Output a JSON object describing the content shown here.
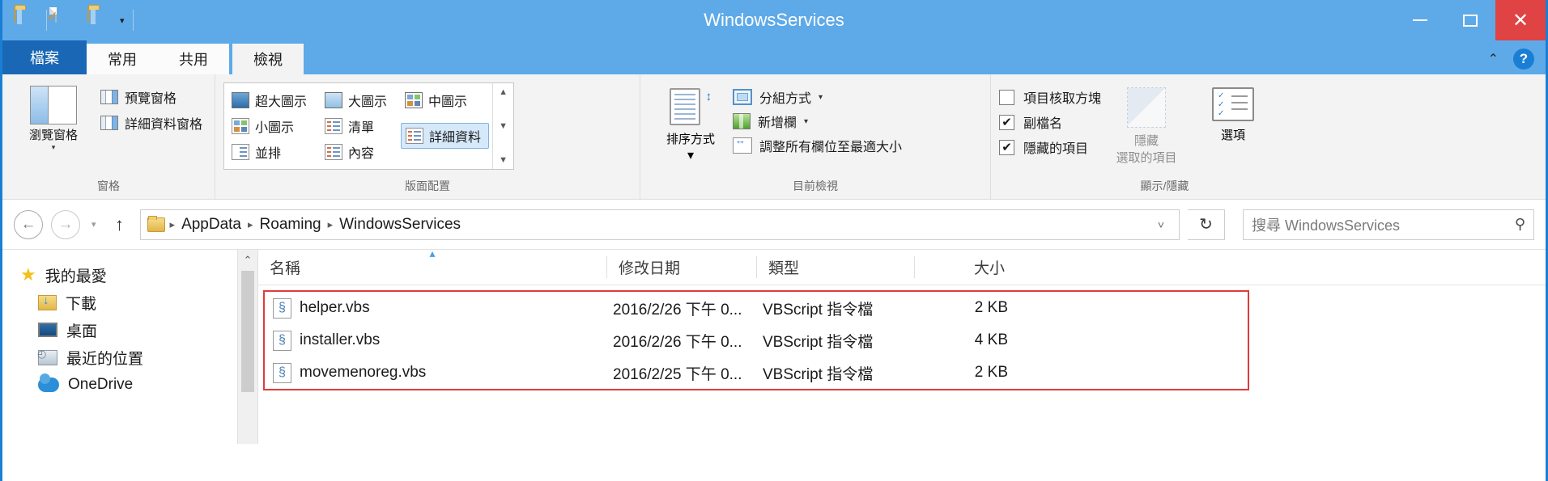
{
  "window": {
    "title": "WindowsServices",
    "minimize_label": "–",
    "maximize_label": "□",
    "close_label": "✕"
  },
  "quick_access": {
    "items": [
      {
        "name": "folder-icon",
        "label": ""
      },
      {
        "name": "new-document-icon",
        "label": ""
      },
      {
        "name": "folder-properties-icon",
        "label": ""
      }
    ],
    "dropdown_caret": "▾"
  },
  "tabs": [
    {
      "id": "file",
      "label": "檔案"
    },
    {
      "id": "home",
      "label": "常用"
    },
    {
      "id": "share",
      "label": "共用"
    },
    {
      "id": "view",
      "label": "檢視"
    }
  ],
  "ribbon_right": {
    "collapse_caret": "⌃",
    "help_label": "?"
  },
  "ribbon": {
    "groups": [
      {
        "id": "panes",
        "label": "窗格",
        "big_button": {
          "label": "瀏覽窗格",
          "caret": "▾"
        },
        "items": [
          {
            "label": "預覽窗格"
          },
          {
            "label": "詳細資料窗格"
          }
        ]
      },
      {
        "id": "layout",
        "label": "版面配置",
        "gallery": [
          {
            "label": "超大圖示",
            "selected": false
          },
          {
            "label": "小圖示",
            "selected": false
          },
          {
            "label": "並排",
            "selected": false
          },
          {
            "label": "大圖示",
            "selected": false
          },
          {
            "label": "清單",
            "selected": false
          },
          {
            "label": "內容",
            "selected": false
          },
          {
            "label": "中圖示",
            "selected": false
          },
          {
            "label": "詳細資料",
            "selected": true
          }
        ],
        "scroll_up": "▲",
        "scroll_down": "▼",
        "scroll_more": "▼"
      },
      {
        "id": "current_view",
        "label": "目前檢視",
        "big_button": {
          "label": "排序方式",
          "caret": "▾"
        },
        "items": [
          {
            "label": "分組方式",
            "caret": "▾"
          },
          {
            "label": "新增欄",
            "caret": "▾"
          },
          {
            "label": "調整所有欄位至最適大小",
            "caret": ""
          }
        ]
      },
      {
        "id": "show_hide",
        "label": "顯示/隱藏",
        "checkboxes": [
          {
            "label": "項目核取方塊",
            "checked": false,
            "mark": ""
          },
          {
            "label": "副檔名",
            "checked": true,
            "mark": "✔"
          },
          {
            "label": "隱藏的項目",
            "checked": true,
            "mark": "✔"
          }
        ],
        "hide_button": {
          "line1": "隱藏",
          "line2": "選取的項目",
          "disabled": true
        },
        "options_button": {
          "label": "選項"
        }
      }
    ]
  },
  "address_bar": {
    "back_label": "←",
    "forward_label": "→",
    "history_caret": "▾",
    "up_label": "↑",
    "breadcrumbs": [
      "AppData",
      "Roaming",
      "WindowsServices"
    ],
    "separator": "▸",
    "dropdown_caret": "˅",
    "refresh_label": "↻",
    "search_placeholder": "搜尋 WindowsServices",
    "search_value": "",
    "search_icon": "⚲"
  },
  "sidebar": {
    "items": [
      {
        "label": "我的最愛",
        "icon": "star-icon",
        "child": false
      },
      {
        "label": "下載",
        "icon": "downloads-icon",
        "child": true
      },
      {
        "label": "桌面",
        "icon": "desktop-icon",
        "child": true
      },
      {
        "label": "最近的位置",
        "icon": "recent-places-icon",
        "child": true
      },
      {
        "label": "OneDrive",
        "icon": "onedrive-icon",
        "child": true
      }
    ]
  },
  "scrollbar": {
    "up_arrow": "⌃",
    "down_arrow": "⌄"
  },
  "file_list": {
    "columns": [
      {
        "key": "name",
        "label": "名稱",
        "sorted": true,
        "sort_indicator": "▴"
      },
      {
        "key": "date",
        "label": "修改日期",
        "sorted": false,
        "sort_indicator": ""
      },
      {
        "key": "type",
        "label": "類型",
        "sorted": false,
        "sort_indicator": ""
      },
      {
        "key": "size",
        "label": "大小",
        "sorted": false,
        "sort_indicator": ""
      }
    ],
    "highlight_color": "#e03b3b",
    "rows": [
      {
        "name": "helper.vbs",
        "date": "2016/2/26 下午 0...",
        "type": "VBScript 指令檔",
        "size": "2 KB"
      },
      {
        "name": "installer.vbs",
        "date": "2016/2/26 下午 0...",
        "type": "VBScript 指令檔",
        "size": "4 KB"
      },
      {
        "name": "movemenoreg.vbs",
        "date": "2016/2/25 下午 0...",
        "type": "VBScript 指令檔",
        "size": "2 KB"
      }
    ]
  },
  "colors": {
    "titlebar": "#5eaae8",
    "file_tab": "#1a68b5",
    "close_button": "#e04343",
    "selection": "#d6e9fb",
    "accent": "#1a7fd4"
  }
}
